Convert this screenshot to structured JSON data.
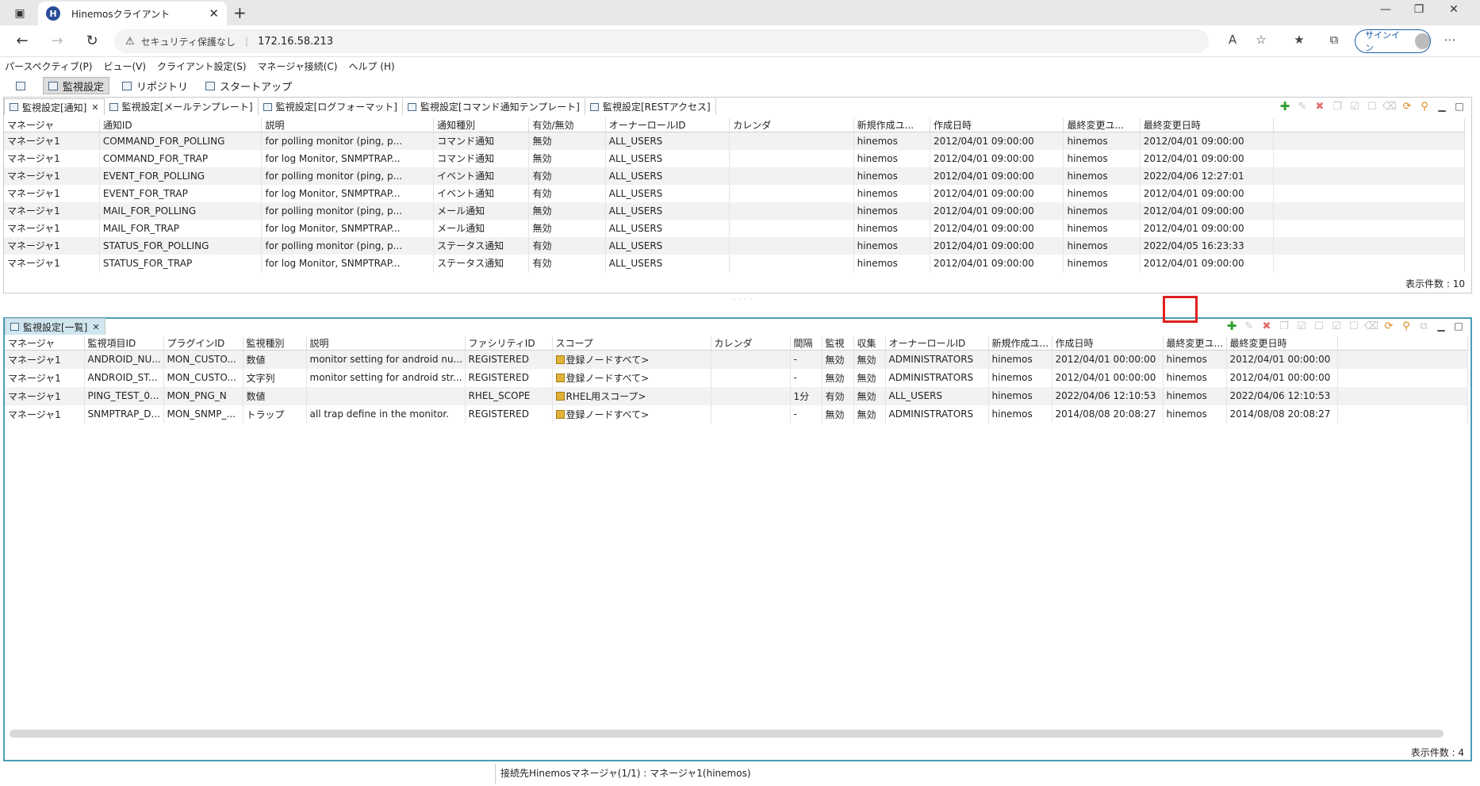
{
  "browser": {
    "tab_title": "Hinemosクライアント",
    "favicon_letter": "H",
    "security_label": "セキュリティ保護なし",
    "url": "172.16.58.213",
    "signin_label": "サインイン"
  },
  "menubar": {
    "items": [
      "パースペクティブ(P)",
      "ビュー(V)",
      "クライアント設定(S)",
      "マネージャ接続(C)",
      "ヘルプ (H)"
    ]
  },
  "perspectives": {
    "items": [
      "監視設定",
      "リポジトリ",
      "スタートアップ"
    ]
  },
  "notify_view": {
    "tabs": [
      "監視設定[通知]",
      "監視設定[メールテンプレート]",
      "監視設定[ログフォーマット]",
      "監視設定[コマンド通知テンプレート]",
      "監視設定[RESTアクセス]"
    ],
    "columns": [
      "マネージャ",
      "通知ID",
      "説明",
      "通知種別",
      "有効/無効",
      "オーナーロールID",
      "カレンダ",
      "新規作成ユ...",
      "作成日時",
      "最終変更ユ...",
      "最終変更日時"
    ],
    "rows": [
      [
        "マネージャ1",
        "COMMAND_FOR_POLLING",
        "for polling monitor (ping, p...",
        "コマンド通知",
        "無効",
        "ALL_USERS",
        "",
        "hinemos",
        "2012/04/01 09:00:00",
        "hinemos",
        "2012/04/01 09:00:00"
      ],
      [
        "マネージャ1",
        "COMMAND_FOR_TRAP",
        "for log Monitor, SNMPTRAP...",
        "コマンド通知",
        "無効",
        "ALL_USERS",
        "",
        "hinemos",
        "2012/04/01 09:00:00",
        "hinemos",
        "2012/04/01 09:00:00"
      ],
      [
        "マネージャ1",
        "EVENT_FOR_POLLING",
        "for polling monitor (ping, p...",
        "イベント通知",
        "有効",
        "ALL_USERS",
        "",
        "hinemos",
        "2012/04/01 09:00:00",
        "hinemos",
        "2022/04/06 12:27:01"
      ],
      [
        "マネージャ1",
        "EVENT_FOR_TRAP",
        "for log Monitor, SNMPTRAP...",
        "イベント通知",
        "有効",
        "ALL_USERS",
        "",
        "hinemos",
        "2012/04/01 09:00:00",
        "hinemos",
        "2012/04/01 09:00:00"
      ],
      [
        "マネージャ1",
        "MAIL_FOR_POLLING",
        "for polling monitor (ping, p...",
        "メール通知",
        "無効",
        "ALL_USERS",
        "",
        "hinemos",
        "2012/04/01 09:00:00",
        "hinemos",
        "2012/04/01 09:00:00"
      ],
      [
        "マネージャ1",
        "MAIL_FOR_TRAP",
        "for log Monitor, SNMPTRAP...",
        "メール通知",
        "無効",
        "ALL_USERS",
        "",
        "hinemos",
        "2012/04/01 09:00:00",
        "hinemos",
        "2012/04/01 09:00:00"
      ],
      [
        "マネージャ1",
        "STATUS_FOR_POLLING",
        "for polling monitor (ping, p...",
        "ステータス通知",
        "有効",
        "ALL_USERS",
        "",
        "hinemos",
        "2012/04/01 09:00:00",
        "hinemos",
        "2022/04/05 16:23:33"
      ],
      [
        "マネージャ1",
        "STATUS_FOR_TRAP",
        "for log Monitor, SNMPTRAP...",
        "ステータス通知",
        "有効",
        "ALL_USERS",
        "",
        "hinemos",
        "2012/04/01 09:00:00",
        "hinemos",
        "2012/04/01 09:00:00"
      ]
    ],
    "count_label": "表示件数 : 10"
  },
  "monitor_view": {
    "tab": "監視設定[一覧]",
    "columns": [
      "マネージャ",
      "監視項目ID",
      "プラグインID",
      "監視種別",
      "説明",
      "ファシリティID",
      "スコープ",
      "カレンダ",
      "間隔",
      "監視",
      "収集",
      "オーナーロールID",
      "新規作成ユ...",
      "作成日時",
      "最終変更ユ...",
      "最終変更日時"
    ],
    "rows": [
      [
        "マネージャ1",
        "ANDROID_NU...",
        "MON_CUSTO...",
        "数値",
        "monitor setting for android nu...",
        "REGISTERED",
        "登録ノードすべて>",
        "",
        "-",
        "無効",
        "無効",
        "ADMINISTRATORS",
        "hinemos",
        "2012/04/01 00:00:00",
        "hinemos",
        "2012/04/01 00:00:00"
      ],
      [
        "マネージャ1",
        "ANDROID_ST...",
        "MON_CUSTO...",
        "文字列",
        "monitor setting for android str...",
        "REGISTERED",
        "登録ノードすべて>",
        "",
        "-",
        "無効",
        "無効",
        "ADMINISTRATORS",
        "hinemos",
        "2012/04/01 00:00:00",
        "hinemos",
        "2012/04/01 00:00:00"
      ],
      [
        "マネージャ1",
        "PING_TEST_0...",
        "MON_PNG_N",
        "数値",
        "",
        "RHEL_SCOPE",
        "RHEL用スコープ>",
        "",
        "1分",
        "有効",
        "無効",
        "ALL_USERS",
        "hinemos",
        "2022/04/06 12:10:53",
        "hinemos",
        "2022/04/06 12:10:53"
      ],
      [
        "マネージャ1",
        "SNMPTRAP_D...",
        "MON_SNMP_...",
        "トラップ",
        "all trap define in the monitor.",
        "REGISTERED",
        "登録ノードすべて>",
        "",
        "-",
        "無効",
        "無効",
        "ADMINISTRATORS",
        "hinemos",
        "2014/08/08 20:08:27",
        "hinemos",
        "2014/08/08 20:08:27"
      ]
    ],
    "count_label": "表示件数 : 4"
  },
  "status_bar": {
    "text": "接続先Hinemosマネージャ(1/1) : マネージャ1(hinemos)"
  }
}
